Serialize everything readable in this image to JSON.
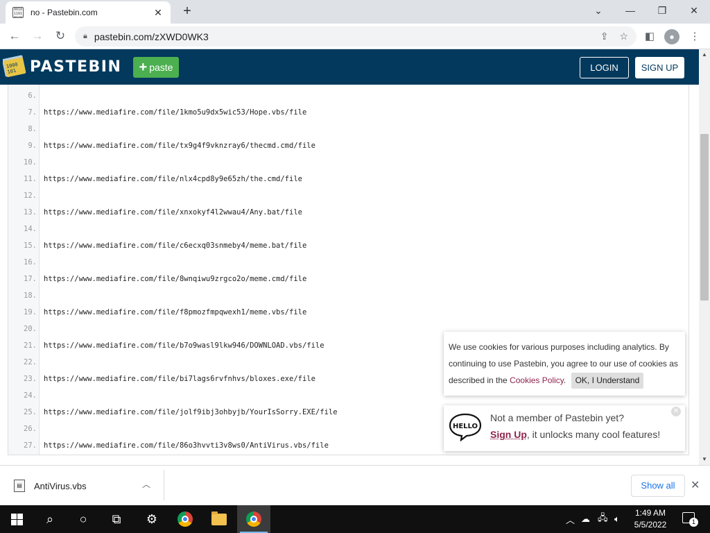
{
  "browser": {
    "tab_title": "no - Pastebin.com",
    "tab_close": "✕",
    "new_tab": "+",
    "url": "pastebin.com/zXWD0WK3"
  },
  "header": {
    "brand": "PASTEBIN",
    "paste_label": "paste",
    "login_label": "LOGIN",
    "signup_label": "SIGN UP"
  },
  "lines": [
    {
      "n": "6.",
      "text": ""
    },
    {
      "n": "7.",
      "text": "https://www.mediafire.com/file/1kmo5u9dx5wic53/Hope.vbs/file"
    },
    {
      "n": "8.",
      "text": ""
    },
    {
      "n": "9.",
      "text": "https://www.mediafire.com/file/tx9g4f9vknzray6/thecmd.cmd/file"
    },
    {
      "n": "10.",
      "text": ""
    },
    {
      "n": "11.",
      "text": "https://www.mediafire.com/file/nlx4cpd8y9e65zh/the.cmd/file"
    },
    {
      "n": "12.",
      "text": ""
    },
    {
      "n": "13.",
      "text": "https://www.mediafire.com/file/xnxokyf4l2wwau4/Any.bat/file"
    },
    {
      "n": "14.",
      "text": ""
    },
    {
      "n": "15.",
      "text": "https://www.mediafire.com/file/c6ecxq03snmeby4/meme.bat/file"
    },
    {
      "n": "16.",
      "text": ""
    },
    {
      "n": "17.",
      "text": "https://www.mediafire.com/file/8wnqiwu9zrgco2o/meme.cmd/file"
    },
    {
      "n": "18.",
      "text": ""
    },
    {
      "n": "19.",
      "text": "https://www.mediafire.com/file/f8pmozfmpqwexh1/meme.vbs/file"
    },
    {
      "n": "20.",
      "text": ""
    },
    {
      "n": "21.",
      "text": "https://www.mediafire.com/file/b7o9wasl9lkw946/DOWNLOAD.vbs/file"
    },
    {
      "n": "22.",
      "text": ""
    },
    {
      "n": "23.",
      "text": "https://www.mediafire.com/file/bi7lags6rvfnhvs/bloxes.exe/file"
    },
    {
      "n": "24.",
      "text": ""
    },
    {
      "n": "25.",
      "text": "https://www.mediafire.com/file/jolf9ibj3ohbyjb/YourIsSorry.EXE/file"
    },
    {
      "n": "26.",
      "text": ""
    },
    {
      "n": "27.",
      "text": "https://www.mediafire.com/file/86o3hvvti3v8ws0/AntiVirus.vbs/file"
    }
  ],
  "cookie": {
    "text_before": "We use cookies for various purposes including analytics. By continuing to use Pastebin, you agree to our use of cookies as described in the ",
    "policy_link": "Cookies Policy",
    "text_after": ".",
    "ok_label": "OK, I Understand"
  },
  "member": {
    "hello": "HELLO",
    "line1": "Not a member of Pastebin yet?",
    "signup_link": "Sign Up",
    "line2_rest": ", it unlocks many cool features!"
  },
  "download": {
    "file_name": "AntiVirus.vbs",
    "show_all": "Show all"
  },
  "taskbar": {
    "time": "1:49 AM",
    "date": "5/5/2022",
    "notification_count": "1"
  },
  "colors": {
    "header_bg": "#02395d",
    "paste_btn": "#4caf50",
    "link": "#8e244d"
  }
}
